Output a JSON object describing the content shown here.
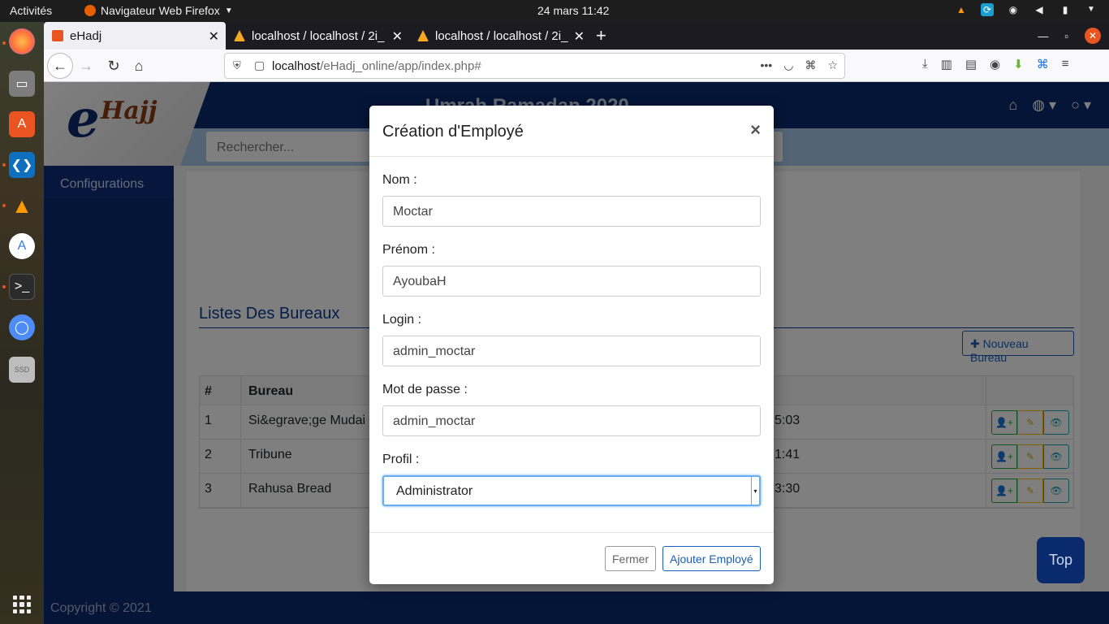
{
  "os": {
    "activities": "Activités",
    "app_menu": "Navigateur Web Firefox",
    "clock": "24 mars  11:42"
  },
  "browser": {
    "tabs": [
      {
        "label": "eHadj",
        "active": true
      },
      {
        "label": "localhost / localhost / 2i_",
        "active": false
      },
      {
        "label": "localhost / localhost / 2i_",
        "active": false
      }
    ],
    "url_host": "localhost",
    "url_path": "/eHadj_online/app/index.php#"
  },
  "page": {
    "logo_e": "e",
    "logo_text": "Hajj",
    "header_title": "Umrah Ramadan 2020",
    "search_placeholder": "Rechercher...",
    "sidebar_item": "Configurations",
    "section_title": "Listes Des Bureaux",
    "new_button": "Nouveau Bureau",
    "table": {
      "headers": [
        "#",
        "Bureau"
      ],
      "rows": [
        {
          "num": "1",
          "bureau": "Si&egrave;ge Mudai",
          "time": "5:03"
        },
        {
          "num": "2",
          "bureau": "Tribune",
          "time": "1:41"
        },
        {
          "num": "3",
          "bureau": "Rahusa Bread",
          "time": "3:30"
        }
      ]
    },
    "footer": "Copyright © 2021",
    "top_button": "Top"
  },
  "modal": {
    "title": "Création d'Employé",
    "close": "×",
    "fields": {
      "nom_label": "Nom :",
      "nom_value": "Moctar",
      "prenom_label": "Prénom :",
      "prenom_value": "AyoubaH",
      "login_label": "Login :",
      "login_value": "admin_moctar",
      "password_label": "Mot de passe :",
      "password_value": "admin_moctar",
      "profil_label": "Profil :",
      "profil_value": "Administrator"
    },
    "cancel_label": "Fermer",
    "submit_label": "Ajouter Employé"
  },
  "colors": {
    "brand_navy": "#0a2a6e",
    "accent_blue": "#1b5fb5",
    "ubuntu_orange": "#e95420"
  }
}
